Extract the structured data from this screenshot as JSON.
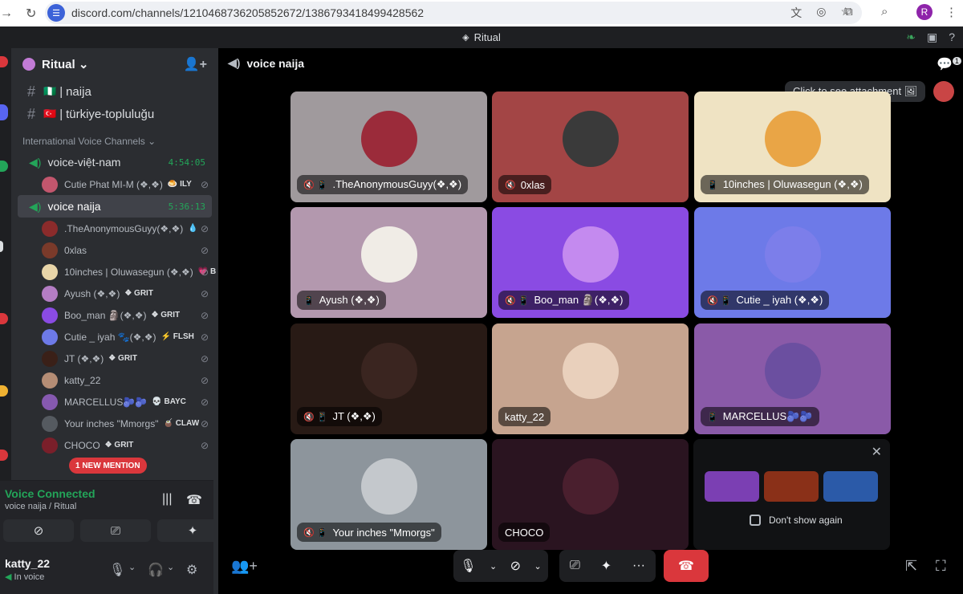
{
  "browser": {
    "url": "discord.com/channels/1210468736205852672/1386793418499428562",
    "profile_initial": "R"
  },
  "window_title": "Ritual",
  "server": {
    "name": "Ritual ⌄",
    "text_channels": [
      {
        "flag": "🇳🇬",
        "name": "naija"
      },
      {
        "flag": "🇹🇷",
        "name": "türkiye-topluluğu"
      }
    ],
    "category": "International Voice Channels ⌄",
    "voice_channels": [
      {
        "name": "voice-việt-nam",
        "timer": "4:54:05",
        "users": [
          {
            "name": "Cutie Phat MI-M (❖,❖)",
            "tag": "🍮 ILY",
            "color": "#c2566d"
          }
        ]
      },
      {
        "name": "voice naija",
        "timer": "5:36:13",
        "users": [
          {
            "name": ".TheAnonymousGuyy(❖,❖)",
            "tag": "💧",
            "color": "#8b2b2b"
          },
          {
            "name": "0xlas",
            "tag": "",
            "color": "#7a3a2a"
          },
          {
            "name": "10inches | Oluwasegun (❖,❖)",
            "tag": "💗 B",
            "color": "#e8d5a8"
          },
          {
            "name": "Ayush (❖,❖)",
            "tag": "❖ GRIT",
            "color": "#b47dc4"
          },
          {
            "name": "Boo_man 🗿(❖,❖)",
            "tag": "❖ GRIT",
            "color": "#8a4be3"
          },
          {
            "name": "Cutie _ iyah 🐾(❖,❖)",
            "tag": "⚡ FLSH",
            "color": "#6d7ae8"
          },
          {
            "name": "JT (❖,❖)",
            "tag": "❖ GRIT",
            "color": "#3a2018"
          },
          {
            "name": "katty_22",
            "tag": "",
            "color": "#b58d75"
          },
          {
            "name": "MARCELLUS🫐🫐",
            "tag": "💀 BAYC",
            "color": "#8659b0"
          },
          {
            "name": "Your inches \"Mmorgs\"",
            "tag": "🧉 CLAW",
            "color": "#555a60"
          },
          {
            "name": "CHOCO",
            "tag": "❖ GRIT",
            "color": "#7a1f2a"
          }
        ]
      }
    ],
    "mention_badge": "1 NEW MENTION"
  },
  "voice_panel": {
    "status": "Voice Connected",
    "location": "voice naija / Ritual"
  },
  "user_panel": {
    "username": "katty_22",
    "status": "In voice"
  },
  "main": {
    "channel_name": "voice naija",
    "tooltip": "Click to see attachment 🖼",
    "thread_count": "1",
    "tiles": [
      {
        "label": ".TheAnonymousGuyy(❖,❖)",
        "icons": "🔇 📱",
        "bg": "#a09a9d",
        "avatar": "#9b2b3a"
      },
      {
        "label": "0xlas",
        "icons": "🔇",
        "bg": "#a34545",
        "avatar": "#3a3a3a"
      },
      {
        "label": "10inches | Oluwasegun (❖,❖)",
        "icons": "📱",
        "bg": "#efe3c3",
        "avatar": "#e9a546"
      },
      {
        "label": "Ayush (❖,❖)",
        "icons": "📱",
        "bg": "#b398ae",
        "avatar": "#f0ece6"
      },
      {
        "label": "Boo_man 🗿(❖,❖)",
        "icons": "🔇 📱",
        "bg": "#8a4be3",
        "avatar": "#c48aef"
      },
      {
        "label": "Cutie _ iyah    (❖,❖)",
        "icons": "🔇 📱",
        "bg": "#6d7ae8",
        "avatar": "#7c7eea"
      },
      {
        "label": "JT (❖,❖)",
        "icons": "🔇 📱",
        "bg": "#281a15",
        "avatar": "#3a2520"
      },
      {
        "label": "katty_22",
        "icons": "",
        "bg": "#c6a48f",
        "avatar": "#e9d0bc"
      },
      {
        "label": "MARCELLUS🫐🫐",
        "icons": "📱",
        "bg": "#8a5aa8",
        "avatar": "#6b4fa0"
      },
      {
        "label": "Your inches \"Mmorgs\"",
        "icons": "🔇 📱",
        "bg": "#8d959c",
        "avatar": "#c4c8cc"
      },
      {
        "label": "CHOCO",
        "icons": "",
        "bg": "#2a1420",
        "avatar": "#4a1f2e"
      }
    ],
    "promo": {
      "dont_show": "Don't show again",
      "games": [
        "#7b3fb3",
        "#8a3018",
        "#2b5aa8"
      ]
    }
  }
}
